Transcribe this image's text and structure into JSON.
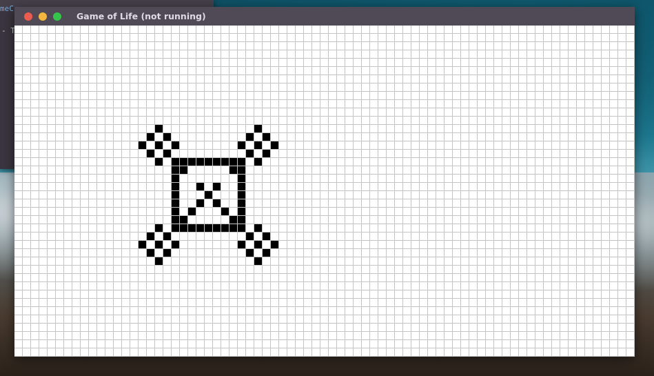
{
  "desktop": {
    "background_window": {
      "text_line_1": "meC",
      "text_line_2": "- T"
    }
  },
  "window": {
    "title": "Game of Life (not running)",
    "controls": {
      "close_color": "#ed5a50",
      "minimize_color": "#f4b73c",
      "maximize_color": "#33c648",
      "close_icon": "close-icon",
      "minimize_icon": "minimize-icon",
      "maximize_icon": "maximize-icon"
    },
    "titlebar_color": "#4f4a56"
  },
  "board": {
    "running": false,
    "grid_line_color": "#c4c4c4",
    "alive_color": "#000000",
    "dead_color": "#ffffff",
    "live_cells": [
      [
        17,
        12
      ],
      [
        29,
        12
      ],
      [
        16,
        13
      ],
      [
        18,
        13
      ],
      [
        28,
        13
      ],
      [
        30,
        13
      ],
      [
        15,
        14
      ],
      [
        17,
        14
      ],
      [
        19,
        14
      ],
      [
        27,
        14
      ],
      [
        29,
        14
      ],
      [
        31,
        14
      ],
      [
        16,
        15
      ],
      [
        18,
        15
      ],
      [
        28,
        15
      ],
      [
        30,
        15
      ],
      [
        17,
        16
      ],
      [
        19,
        16
      ],
      [
        20,
        16
      ],
      [
        21,
        16
      ],
      [
        22,
        16
      ],
      [
        23,
        16
      ],
      [
        24,
        16
      ],
      [
        25,
        16
      ],
      [
        26,
        16
      ],
      [
        27,
        16
      ],
      [
        29,
        16
      ],
      [
        19,
        17
      ],
      [
        20,
        17
      ],
      [
        26,
        17
      ],
      [
        27,
        17
      ],
      [
        19,
        18
      ],
      [
        27,
        18
      ],
      [
        19,
        19
      ],
      [
        22,
        19
      ],
      [
        24,
        19
      ],
      [
        27,
        19
      ],
      [
        19,
        20
      ],
      [
        23,
        20
      ],
      [
        27,
        20
      ],
      [
        19,
        21
      ],
      [
        22,
        21
      ],
      [
        24,
        21
      ],
      [
        27,
        21
      ],
      [
        19,
        22
      ],
      [
        21,
        22
      ],
      [
        25,
        22
      ],
      [
        27,
        22
      ],
      [
        19,
        23
      ],
      [
        20,
        23
      ],
      [
        26,
        23
      ],
      [
        27,
        23
      ],
      [
        17,
        24
      ],
      [
        19,
        24
      ],
      [
        20,
        24
      ],
      [
        21,
        24
      ],
      [
        22,
        24
      ],
      [
        23,
        24
      ],
      [
        24,
        24
      ],
      [
        25,
        24
      ],
      [
        26,
        24
      ],
      [
        27,
        24
      ],
      [
        29,
        24
      ],
      [
        16,
        25
      ],
      [
        18,
        25
      ],
      [
        28,
        25
      ],
      [
        30,
        25
      ],
      [
        15,
        26
      ],
      [
        17,
        26
      ],
      [
        19,
        26
      ],
      [
        27,
        26
      ],
      [
        29,
        26
      ],
      [
        31,
        26
      ],
      [
        16,
        27
      ],
      [
        18,
        27
      ],
      [
        28,
        27
      ],
      [
        30,
        27
      ],
      [
        17,
        28
      ],
      [
        29,
        28
      ]
    ]
  }
}
